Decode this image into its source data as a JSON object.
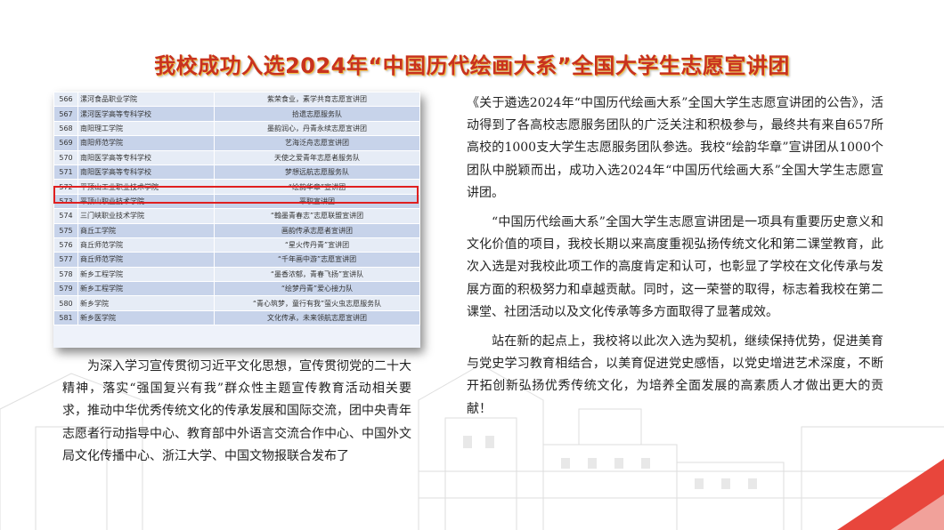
{
  "title": "我校成功入选2024年“中国历代绘画大系”全国大学生志愿宣讲团",
  "table_rows": [
    {
      "num": "566",
      "school": "漯河食品职业学院",
      "team": "紫荣食业，素学共育志愿宣讲团"
    },
    {
      "num": "567",
      "school": "漯河医学高等专科学校",
      "team": "拾遗志愿服务队"
    },
    {
      "num": "568",
      "school": "南阳理工学院",
      "team": "墨韵润心，丹青永续志愿宣讲团"
    },
    {
      "num": "569",
      "school": "南阳师范学院",
      "team": "艺海泛舟志愿宣讲团"
    },
    {
      "num": "570",
      "school": "南阳医学高等专科学校",
      "team": "天使之爱青年志愿者服务队"
    },
    {
      "num": "571",
      "school": "南阳医学高等专科学校",
      "team": "梦想远航志愿服务队"
    },
    {
      "num": "572",
      "school": "平顶山工业职业技术学院",
      "team": "“绘韵华章”宣讲团"
    },
    {
      "num": "573",
      "school": "平顶山职业技术学院",
      "team": "平职宣讲团"
    },
    {
      "num": "574",
      "school": "三门峡职业技术学院",
      "team": "“翰墨青春志”志愿联盟宣讲团"
    },
    {
      "num": "575",
      "school": "商丘工学院",
      "team": "画韵传承志愿者宣讲团"
    },
    {
      "num": "576",
      "school": "商丘师范学院",
      "team": "“星火传丹青”宣讲团"
    },
    {
      "num": "577",
      "school": "商丘师范学院",
      "team": "“千年画中游”志愿宣讲团"
    },
    {
      "num": "578",
      "school": "新乡工程学院",
      "team": "“墨香浓郁，青春飞扬”宣讲队"
    },
    {
      "num": "579",
      "school": "新乡工程学院",
      "team": "“绘梦丹青”爱心接力队"
    },
    {
      "num": "580",
      "school": "新乡学院",
      "team": "“青心筑梦，童行有我”萤火虫志愿服务队"
    },
    {
      "num": "581",
      "school": "新乡医学院",
      "team": "文化传承，未来领航志愿宣讲团"
    }
  ],
  "left_paragraph": "为深入学习宣传贯彻习近平文化思想，宣传贯彻党的二十大精神，落实“强国复兴有我”群众性主题宣传教育活动相关要求，推动中华优秀传统文化的传承发展和国际交流，团中央青年志愿者行动指导中心、教育部中外语言交流合作中心、中国外文局文化传播中心、浙江大学、中国文物报联合发布了",
  "right_paragraphs": [
    "《关于遴选2024年“中国历代绘画大系”全国大学生志愿宣讲团的公告》，活动得到了各高校志愿服务团队的广泛关注和积极参与，最终共有来自657所高校的1000支大学生志愿服务团队参选。我校“绘韵华章”宣讲团从1000个团队中脱颖而出，成功入选2024年“中国历代绘画大系”全国大学生志愿宣讲团。",
    "“中国历代绘画大系”全国大学生志愿宣讲团是一项具有重要历史意义和文化价值的项目，我校长期以来高度重视弘扬传统文化和第二课堂教育，此次入选是对我校此项工作的高度肯定和认可，也彰显了学校在文化传承与发展方面的积极努力和卓越贡献。同时，这一荣誉的取得，标志着我校在第二课堂、社团活动以及文化传承等多方面取得了显著成效。",
    "站在新的起点上，我校将以此次入选为契机，继续保持优势，促进美育与党史学习教育相结合，以美育促进党史感悟，以党史增进艺术深度，不断开拓创新弘扬优秀传统文化，为培养全面发展的高素质人才做出更大的贡献！"
  ],
  "colors": {
    "title": "#c8321e",
    "highlight_border": "#e02020",
    "corner_accent": "#e8463c"
  }
}
